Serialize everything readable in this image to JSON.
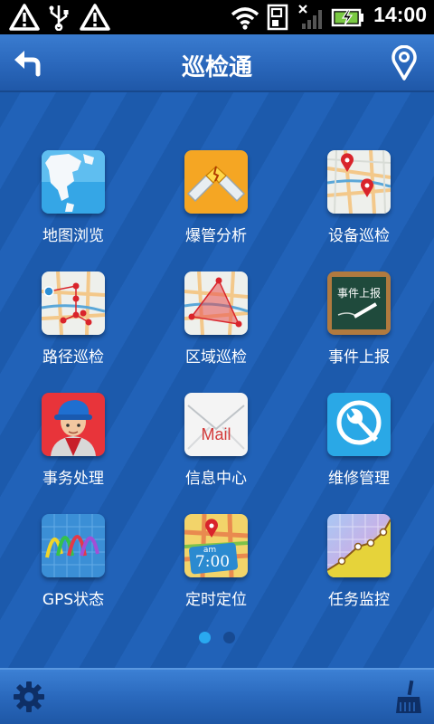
{
  "status_bar": {
    "time": "14:00",
    "icons": [
      "warning-icon",
      "usb-icon",
      "warning-icon",
      "wifi-icon",
      "sd-card-icon",
      "no-signal-icon",
      "battery-charging-icon"
    ]
  },
  "header": {
    "title": "巡检通",
    "back_icon": "back-arrow-icon",
    "location_icon": "location-pin-icon"
  },
  "apps": [
    {
      "label": "地图浏览",
      "icon": "world-map-icon"
    },
    {
      "label": "爆管分析",
      "icon": "pipe-burst-icon"
    },
    {
      "label": "设备巡检",
      "icon": "device-map-pins-icon"
    },
    {
      "label": "路径巡检",
      "icon": "route-map-icon"
    },
    {
      "label": "区域巡检",
      "icon": "area-map-icon"
    },
    {
      "label": "事件上报",
      "icon": "blackboard-icon"
    },
    {
      "label": "事务处理",
      "icon": "worker-icon"
    },
    {
      "label": "信息中心",
      "icon": "mail-icon"
    },
    {
      "label": "维修管理",
      "icon": "wrench-icon"
    },
    {
      "label": "GPS状态",
      "icon": "gps-wave-icon"
    },
    {
      "label": "定时定位",
      "icon": "clock-map-icon"
    },
    {
      "label": "任务监控",
      "icon": "line-chart-icon"
    }
  ],
  "icon_text": {
    "blackboard": "事件上报",
    "mail": "Mail",
    "clock": "7:00",
    "clock_am": "am"
  },
  "pager": {
    "current": 1,
    "total": 2,
    "active_color": "#29a9f0",
    "inactive_color": "#174a92"
  },
  "bottom_bar": {
    "left_icon": "gear-icon",
    "right_icon": "broom-icon"
  }
}
